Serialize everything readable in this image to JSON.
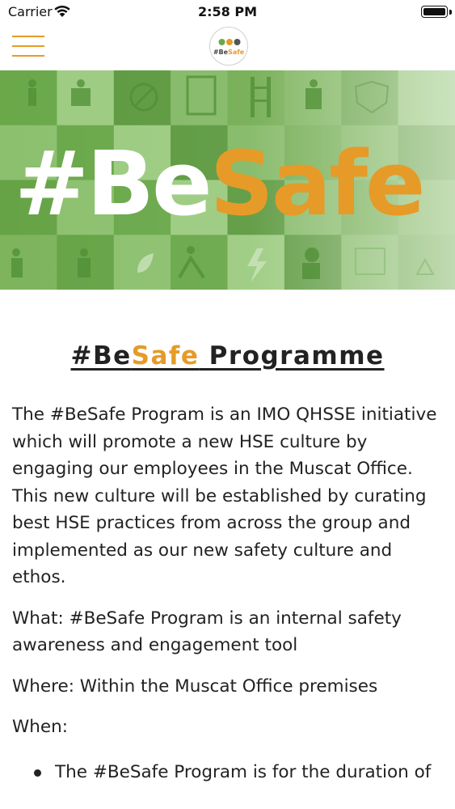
{
  "status_bar": {
    "carrier": "Carrier",
    "time": "2:58 PM"
  },
  "nav": {
    "menu_icon": "hamburger-menu-icon",
    "logo_text_prefix": "#Be",
    "logo_text_highlight": "Safe"
  },
  "banner": {
    "text_prefix": "#Be",
    "text_highlight": "Safe",
    "colors": {
      "green": "#6aa84a",
      "orange": "#e69a28"
    }
  },
  "main": {
    "title_prefix": "#Be",
    "title_highlight": "Safe",
    "title_suffix": " Programme",
    "intro": "The #BeSafe Program is an IMO QHSSE initiative which will promote a new HSE culture by engaging our employees in the Muscat Office. This new culture will be established by curating best HSE practices from across the group and implemented as our new safety culture and ethos.",
    "what_label": "What:",
    "what_text": " #BeSafe Program is an internal safety awareness and engagement tool",
    "where_label": "Where:",
    "where_text": " Within the Muscat Office premises",
    "when_label": "When:",
    "bullets": [
      "The #BeSafe Program is for the duration of"
    ]
  },
  "accent_color": "#e69a28"
}
